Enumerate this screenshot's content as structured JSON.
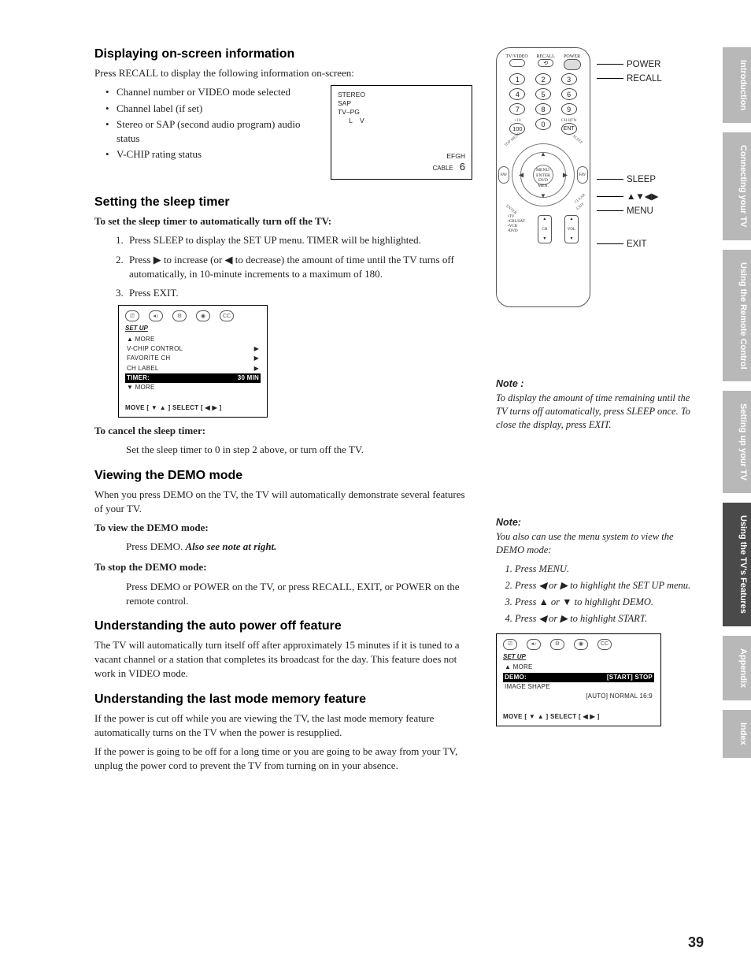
{
  "pageNumber": "39",
  "sideTabs": [
    "Introduction",
    "Connecting your TV",
    "Using the Remote Control",
    "Setting up your TV",
    "Using the TV's Features",
    "Appendix",
    "Index"
  ],
  "activeTabIndex": 4,
  "remote": {
    "topLabels": [
      "TV/VIDEO",
      "RECALL",
      "POWER"
    ],
    "numLabels": [
      "1",
      "2",
      "3",
      "4",
      "5",
      "6",
      "7",
      "8",
      "9",
      "100",
      "0",
      "ENT"
    ],
    "extraLabels": {
      "plus10": "+10",
      "chrtn": "CH RTN"
    },
    "centerLabel": "MENU/\nENTER\nDVD MEN.",
    "fav": "FAV",
    "diag": {
      "tl": "TOP MENU",
      "tr": "SLEEP",
      "bl": "ENTER",
      "br": "EXIT",
      "brAlt": "CLEAR"
    },
    "rockers": {
      "ch": "CH",
      "vol": "VOL"
    },
    "modeList": "•TV\n•CBL/SAT\n•VCR\n•DVD"
  },
  "callouts": {
    "power": "POWER",
    "recall": "RECALL",
    "sleep": "SLEEP",
    "arrows": "▲▼◀▶",
    "menu": "MENU",
    "exit": "EXIT"
  },
  "note1": {
    "heading": "Note :",
    "body": "To display the amount of time remaining until the TV turns off automatically, press SLEEP once. To close the display, press EXIT."
  },
  "note2": {
    "heading": "Note:",
    "body": "You also can use the menu system to view the DEMO mode:",
    "steps": [
      "Press MENU.",
      "Press ◀ or ▶ to highlight the SET UP menu.",
      "Press ▲ or ▼ to highlight DEMO.",
      "Press ◀ or ▶ to highlight START."
    ]
  },
  "menuDemo": {
    "title": "SET UP",
    "more1": "▲ MORE",
    "rows": [
      {
        "l": "DEMO:",
        "r": "[START] STOP",
        "hl": true
      },
      {
        "l": "IMAGE SHAPE",
        "r": "",
        "hl": false
      },
      {
        "l": "",
        "r": "[AUTO] NORMAL 16:9",
        "hl": false
      }
    ],
    "footer": "MOVE [ ▼ ▲ ]     SELECT [ ◀  ▶ ]"
  },
  "sections": {
    "display": {
      "heading": "Displaying on-screen information",
      "intro": "Press RECALL to display the following information on-screen:",
      "bullets": [
        "Channel number or VIDEO mode selected",
        "Channel label (if set)",
        "Stereo or SAP (second audio program) audio status",
        "V-CHIP rating status"
      ],
      "osd": {
        "top": "STEREO\nSAP\nTV–PG\n      L    V",
        "bottomLabel": "EFGH",
        "bottomMode": "CABLE",
        "bottomCh": "6"
      }
    },
    "sleep": {
      "heading": "Setting the sleep timer",
      "sub1": "To set the sleep timer to automatically turn off the TV:",
      "steps": [
        "Press SLEEP to display the SET UP menu. TIMER will be highlighted.",
        "Press ▶ to increase (or ◀ to decrease) the amount of time until the TV turns off automatically, in 10-minute increments to a maximum of 180.",
        "Press EXIT."
      ],
      "menu": {
        "title": "SET UP",
        "more1": "▲ MORE",
        "rows": [
          {
            "l": "V-CHIP CONTROL",
            "r": "▶",
            "hl": false
          },
          {
            "l": "FAVORITE CH",
            "r": "▶",
            "hl": false
          },
          {
            "l": "CH LABEL",
            "r": "▶",
            "hl": false
          },
          {
            "l": "TIMER:",
            "r": "30 MIN",
            "hl": true
          }
        ],
        "more2": "▼ MORE",
        "footer": "MOVE [ ▼ ▲ ]     SELECT [ ◀  ▶ ]"
      },
      "sub2": "To cancel the sleep timer:",
      "cancel": "Set the sleep timer to 0 in step 2 above, or turn off the TV."
    },
    "demo": {
      "heading": "Viewing the DEMO mode",
      "intro": "When you press DEMO on the TV, the TV will automatically demonstrate several features of your TV.",
      "sub1": "To view the DEMO mode:",
      "view1": "Press DEMO. ",
      "view2": "Also see note at right.",
      "sub2": "To stop the DEMO mode:",
      "stop": "Press DEMO or POWER on the TV, or press RECALL, EXIT, or POWER on the remote control."
    },
    "autoOff": {
      "heading": "Understanding the auto power off feature",
      "body": "The TV will automatically turn itself off after approximately 15 minutes if it is tuned to a vacant channel or a station that completes its broadcast for the day. This feature does not work in VIDEO mode."
    },
    "lastMode": {
      "heading": "Understanding the last mode memory feature",
      "p1": "If the power is cut off while you are viewing the TV, the last mode memory feature automatically turns on the TV when the power is resupplied.",
      "p2": "If the power is going to be off for a long time or you are going to be away from your TV, unplug the power cord to prevent the TV from turning on in your absence."
    }
  }
}
